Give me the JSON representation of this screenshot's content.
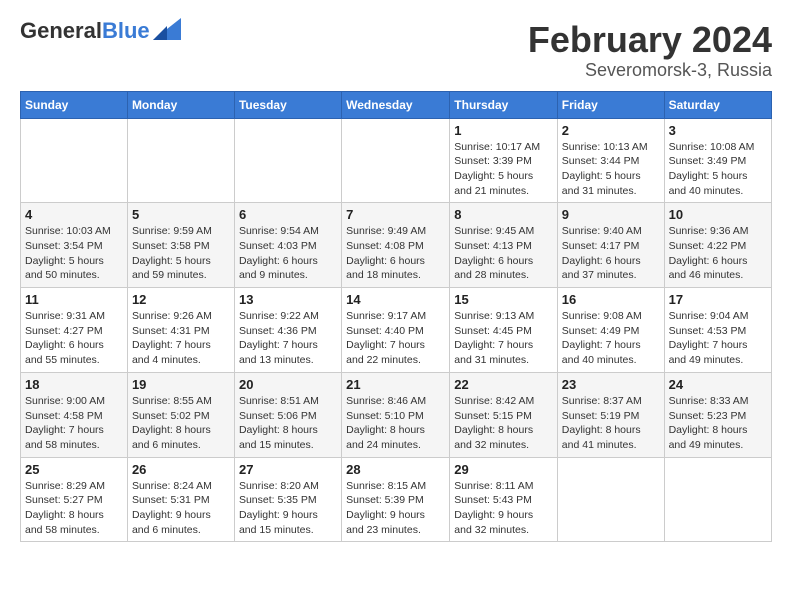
{
  "header": {
    "logo_general": "General",
    "logo_blue": "Blue",
    "month": "February 2024",
    "location": "Severomorsk-3, Russia"
  },
  "weekdays": [
    "Sunday",
    "Monday",
    "Tuesday",
    "Wednesday",
    "Thursday",
    "Friday",
    "Saturday"
  ],
  "weeks": [
    [
      {
        "day": "",
        "info": ""
      },
      {
        "day": "",
        "info": ""
      },
      {
        "day": "",
        "info": ""
      },
      {
        "day": "",
        "info": ""
      },
      {
        "day": "1",
        "info": "Sunrise: 10:17 AM\nSunset: 3:39 PM\nDaylight: 5 hours\nand 21 minutes."
      },
      {
        "day": "2",
        "info": "Sunrise: 10:13 AM\nSunset: 3:44 PM\nDaylight: 5 hours\nand 31 minutes."
      },
      {
        "day": "3",
        "info": "Sunrise: 10:08 AM\nSunset: 3:49 PM\nDaylight: 5 hours\nand 40 minutes."
      }
    ],
    [
      {
        "day": "4",
        "info": "Sunrise: 10:03 AM\nSunset: 3:54 PM\nDaylight: 5 hours\nand 50 minutes."
      },
      {
        "day": "5",
        "info": "Sunrise: 9:59 AM\nSunset: 3:58 PM\nDaylight: 5 hours\nand 59 minutes."
      },
      {
        "day": "6",
        "info": "Sunrise: 9:54 AM\nSunset: 4:03 PM\nDaylight: 6 hours\nand 9 minutes."
      },
      {
        "day": "7",
        "info": "Sunrise: 9:49 AM\nSunset: 4:08 PM\nDaylight: 6 hours\nand 18 minutes."
      },
      {
        "day": "8",
        "info": "Sunrise: 9:45 AM\nSunset: 4:13 PM\nDaylight: 6 hours\nand 28 minutes."
      },
      {
        "day": "9",
        "info": "Sunrise: 9:40 AM\nSunset: 4:17 PM\nDaylight: 6 hours\nand 37 minutes."
      },
      {
        "day": "10",
        "info": "Sunrise: 9:36 AM\nSunset: 4:22 PM\nDaylight: 6 hours\nand 46 minutes."
      }
    ],
    [
      {
        "day": "11",
        "info": "Sunrise: 9:31 AM\nSunset: 4:27 PM\nDaylight: 6 hours\nand 55 minutes."
      },
      {
        "day": "12",
        "info": "Sunrise: 9:26 AM\nSunset: 4:31 PM\nDaylight: 7 hours\nand 4 minutes."
      },
      {
        "day": "13",
        "info": "Sunrise: 9:22 AM\nSunset: 4:36 PM\nDaylight: 7 hours\nand 13 minutes."
      },
      {
        "day": "14",
        "info": "Sunrise: 9:17 AM\nSunset: 4:40 PM\nDaylight: 7 hours\nand 22 minutes."
      },
      {
        "day": "15",
        "info": "Sunrise: 9:13 AM\nSunset: 4:45 PM\nDaylight: 7 hours\nand 31 minutes."
      },
      {
        "day": "16",
        "info": "Sunrise: 9:08 AM\nSunset: 4:49 PM\nDaylight: 7 hours\nand 40 minutes."
      },
      {
        "day": "17",
        "info": "Sunrise: 9:04 AM\nSunset: 4:53 PM\nDaylight: 7 hours\nand 49 minutes."
      }
    ],
    [
      {
        "day": "18",
        "info": "Sunrise: 9:00 AM\nSunset: 4:58 PM\nDaylight: 7 hours\nand 58 minutes."
      },
      {
        "day": "19",
        "info": "Sunrise: 8:55 AM\nSunset: 5:02 PM\nDaylight: 8 hours\nand 6 minutes."
      },
      {
        "day": "20",
        "info": "Sunrise: 8:51 AM\nSunset: 5:06 PM\nDaylight: 8 hours\nand 15 minutes."
      },
      {
        "day": "21",
        "info": "Sunrise: 8:46 AM\nSunset: 5:10 PM\nDaylight: 8 hours\nand 24 minutes."
      },
      {
        "day": "22",
        "info": "Sunrise: 8:42 AM\nSunset: 5:15 PM\nDaylight: 8 hours\nand 32 minutes."
      },
      {
        "day": "23",
        "info": "Sunrise: 8:37 AM\nSunset: 5:19 PM\nDaylight: 8 hours\nand 41 minutes."
      },
      {
        "day": "24",
        "info": "Sunrise: 8:33 AM\nSunset: 5:23 PM\nDaylight: 8 hours\nand 49 minutes."
      }
    ],
    [
      {
        "day": "25",
        "info": "Sunrise: 8:29 AM\nSunset: 5:27 PM\nDaylight: 8 hours\nand 58 minutes."
      },
      {
        "day": "26",
        "info": "Sunrise: 8:24 AM\nSunset: 5:31 PM\nDaylight: 9 hours\nand 6 minutes."
      },
      {
        "day": "27",
        "info": "Sunrise: 8:20 AM\nSunset: 5:35 PM\nDaylight: 9 hours\nand 15 minutes."
      },
      {
        "day": "28",
        "info": "Sunrise: 8:15 AM\nSunset: 5:39 PM\nDaylight: 9 hours\nand 23 minutes."
      },
      {
        "day": "29",
        "info": "Sunrise: 8:11 AM\nSunset: 5:43 PM\nDaylight: 9 hours\nand 32 minutes."
      },
      {
        "day": "",
        "info": ""
      },
      {
        "day": "",
        "info": ""
      }
    ]
  ]
}
